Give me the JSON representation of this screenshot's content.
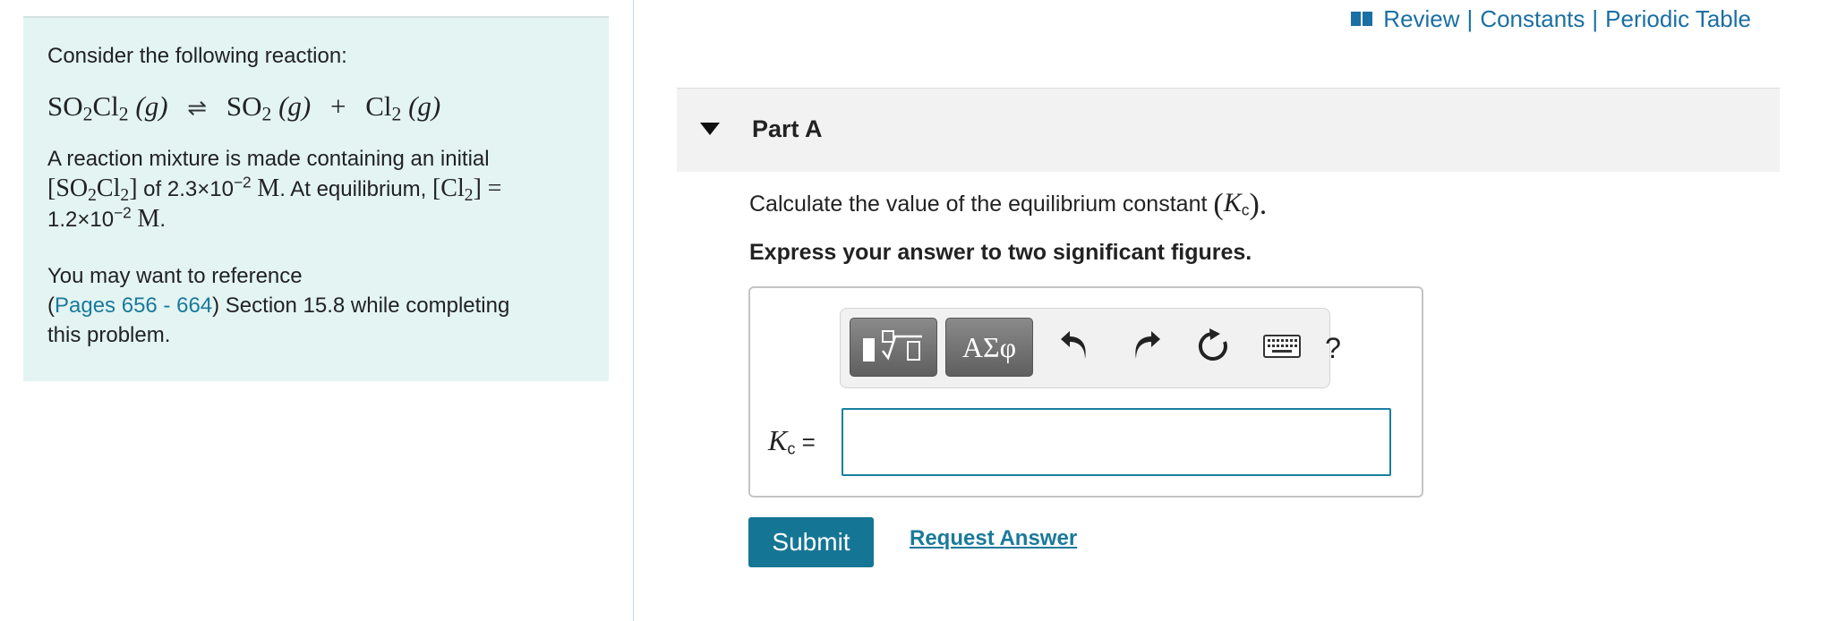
{
  "colors": {
    "accent": "#157595",
    "link": "#1a6fa3",
    "left_panel_bg": "#e3f4f3",
    "part_header_bg": "#f2f2f2"
  },
  "header_links": {
    "icon": "book-icon",
    "review": "Review",
    "separator": "|",
    "constants": "Constants",
    "periodic_table": "Periodic Table"
  },
  "problem": {
    "intro": "Consider the following reaction:",
    "reaction": {
      "reactant": {
        "s1": "SO",
        "n1": "2",
        "s2": "Cl",
        "n2": "2"
      },
      "reactant_phase": "(g)",
      "arrow": "⇌",
      "product1": {
        "s1": "SO",
        "n1": "2"
      },
      "product1_phase": "(g)",
      "plus": "+",
      "product2": {
        "s1": "Cl",
        "n1": "2"
      },
      "product2_phase": "(g)"
    },
    "mixture": {
      "text1": "A reaction mixture is made containing an initial",
      "species1": {
        "open": "[",
        "s1": "SO",
        "n1": "2",
        "s2": "Cl",
        "n2": "2",
        "close": "]"
      },
      "text2": " of ",
      "value1_mantissa": "2.3×10",
      "value1_exp": "−2",
      "unit": "M",
      "text3": ". At equilibrium, ",
      "species2": {
        "open": "[",
        "s1": "Cl",
        "n1": "2",
        "close": "]"
      },
      "equals": "=",
      "value2_mantissa": "1.2×10",
      "value2_exp": "−2",
      "end": "."
    },
    "reference": {
      "text1": "You may want to reference",
      "open_paren": "(",
      "link": "Pages 656 - 664",
      "text2": ") Section 15.8 while completing",
      "text3": "this problem."
    }
  },
  "part": {
    "toggle_icon": "triangle-down-icon",
    "title": "Part A",
    "question_text": "Calculate the value of the equilibrium constant ",
    "question_open": "(",
    "question_k": "K",
    "question_sub": "c",
    "question_close": ").",
    "instruction": "Express your answer to two significant figures."
  },
  "answer": {
    "toolbar": {
      "templates_icon": "templates-icon",
      "greek": "ΑΣφ",
      "undo_icon": "undo-icon",
      "redo_icon": "redo-icon",
      "reset_icon": "reset-icon",
      "keyboard_icon": "keyboard-icon",
      "help": "?"
    },
    "label_k": "K",
    "label_sub": "c",
    "label_eq": " =",
    "input_value": "",
    "input_placeholder": ""
  },
  "actions": {
    "submit": "Submit",
    "request_answer": "Request Answer"
  }
}
